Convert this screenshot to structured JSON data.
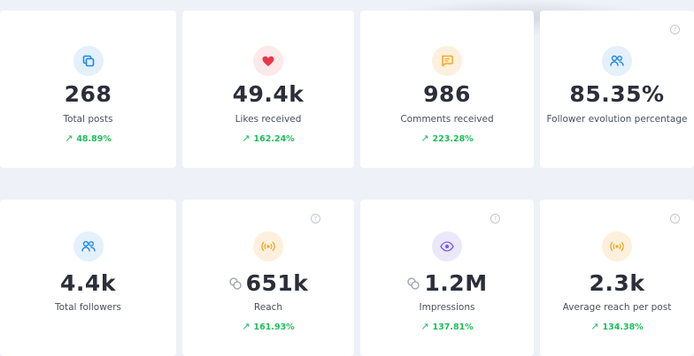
{
  "row1": [
    {
      "value": "268",
      "label": "Total posts",
      "trend": "48.89%",
      "icon": "posts-icon",
      "color": "#1e88e5"
    },
    {
      "value": "49.4k",
      "label": "Likes received",
      "trend": "162.24%",
      "icon": "heart-icon",
      "color": "#e5394a"
    },
    {
      "value": "986",
      "label": "Comments received",
      "trend": "223.28%",
      "icon": "comment-icon",
      "color": "#f5a623"
    },
    {
      "value": "85.35%",
      "label": "Follower evolution percentage",
      "trend": "",
      "icon": "followers-icon",
      "color": "#1e88e5"
    }
  ],
  "row2": [
    {
      "value": "4.4k",
      "label": "Total followers",
      "trend": "",
      "icon": "followers-icon",
      "color": "#1e88e5"
    },
    {
      "value": "651k",
      "label": "Reach",
      "trend": "161.93%",
      "icon": "broadcast-icon",
      "color": "#f5a623"
    },
    {
      "value": "1.2M",
      "label": "Impressions",
      "trend": "137.81%",
      "icon": "eye-icon",
      "color": "#7b5cf0"
    },
    {
      "value": "2.3k",
      "label": "Average reach per post",
      "trend": "134.38%",
      "icon": "broadcast-icon",
      "color": "#f5a623"
    }
  ],
  "trend_arrow": "↗",
  "help_glyph": "?"
}
